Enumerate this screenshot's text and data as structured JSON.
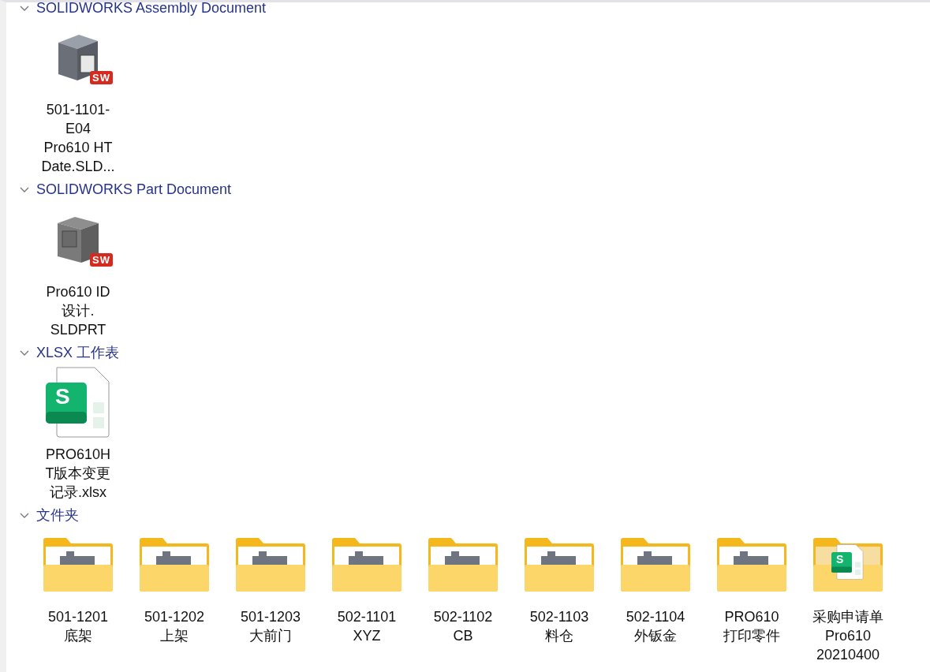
{
  "groups": [
    {
      "title": "SOLIDWORKS Assembly Document",
      "expanded": true,
      "items": [
        {
          "kind": "assembly",
          "badge": "SW",
          "lines": [
            "501-1101-",
            "E04",
            "Pro610 HT",
            "Date.SLD..."
          ]
        }
      ]
    },
    {
      "title": "SOLIDWORKS Part Document",
      "expanded": true,
      "items": [
        {
          "kind": "part",
          "badge": "SW",
          "lines": [
            "Pro610 ID",
            "设计.",
            "SLDPRT"
          ]
        }
      ]
    },
    {
      "title": "XLSX 工作表",
      "expanded": true,
      "items": [
        {
          "kind": "sheet",
          "badge": "S",
          "lines": [
            "PRO610H",
            "T版本变更",
            "记录.xlsx"
          ]
        }
      ]
    },
    {
      "title": "文件夹",
      "expanded": true,
      "items": [
        {
          "kind": "folder",
          "lines": [
            "501-1201",
            "底架"
          ]
        },
        {
          "kind": "folder",
          "lines": [
            "501-1202",
            "上架"
          ]
        },
        {
          "kind": "folder",
          "lines": [
            "501-1203",
            "大前门"
          ]
        },
        {
          "kind": "folder",
          "lines": [
            "502-1101",
            "XYZ"
          ]
        },
        {
          "kind": "folder",
          "lines": [
            "502-1102",
            "CB"
          ]
        },
        {
          "kind": "folder",
          "lines": [
            "502-1103",
            "料仓"
          ]
        },
        {
          "kind": "folder",
          "lines": [
            "502-1104",
            "外钣金"
          ]
        },
        {
          "kind": "folder",
          "lines": [
            "PRO610",
            "打印零件"
          ]
        },
        {
          "kind": "sheet-folder",
          "badge": "S",
          "lines": [
            "采购申请单",
            "Pro610",
            "20210400"
          ]
        }
      ]
    }
  ]
}
